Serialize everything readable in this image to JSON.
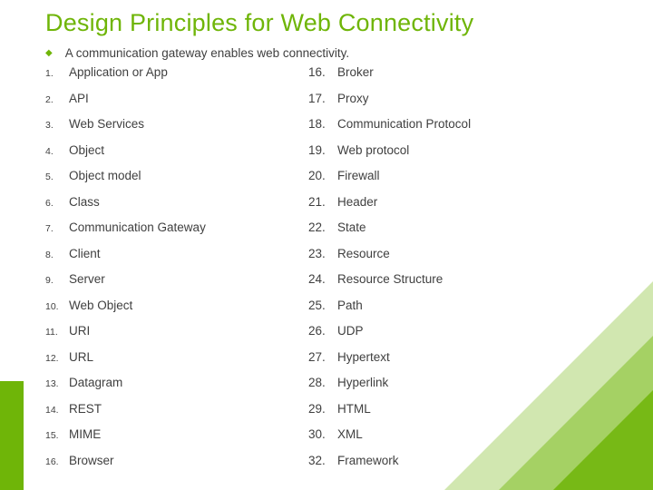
{
  "title": "Design Principles for Web Connectivity",
  "intro": "A communication gateway enables web connectivity.",
  "left": [
    {
      "n": "1.",
      "t": "Application or App"
    },
    {
      "n": "2.",
      "t": "API"
    },
    {
      "n": "3.",
      "t": "Web Services"
    },
    {
      "n": "4.",
      "t": "Object"
    },
    {
      "n": "5.",
      "t": "Object model"
    },
    {
      "n": "6.",
      "t": "Class"
    },
    {
      "n": "7.",
      "t": "Communication Gateway"
    },
    {
      "n": "8.",
      "t": "Client"
    },
    {
      "n": "9.",
      "t": "Server"
    },
    {
      "n": "10.",
      "t": "Web Object"
    },
    {
      "n": "11.",
      "t": "URI"
    },
    {
      "n": "12.",
      "t": "URL"
    },
    {
      "n": "13.",
      "t": "Datagram"
    },
    {
      "n": "14.",
      "t": "REST"
    },
    {
      "n": "15.",
      "t": "MIME"
    },
    {
      "n": "16.",
      "t": "Browser"
    }
  ],
  "right": [
    {
      "n": "16.",
      "t": "Broker"
    },
    {
      "n": "17.",
      "t": "Proxy"
    },
    {
      "n": "18.",
      "t": "Communication Protocol"
    },
    {
      "n": "19.",
      "t": "Web protocol"
    },
    {
      "n": "20.",
      "t": "Firewall"
    },
    {
      "n": "21.",
      "t": "Header"
    },
    {
      "n": "22.",
      "t": "State"
    },
    {
      "n": "23.",
      "t": "Resource"
    },
    {
      "n": "24.",
      "t": "Resource Structure"
    },
    {
      "n": "25.",
      "t": "Path"
    },
    {
      "n": "26.",
      "t": "UDP"
    },
    {
      "n": "27.",
      "t": "Hypertext"
    },
    {
      "n": "28.",
      "t": "Hyperlink"
    },
    {
      "n": "29.",
      "t": "HTML"
    },
    {
      "n": "30.",
      "t": "XML"
    },
    {
      "n": "32.",
      "t": "Framework"
    }
  ]
}
